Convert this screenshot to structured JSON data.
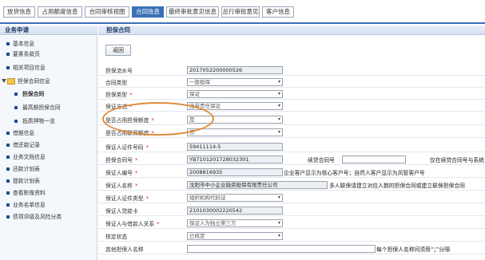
{
  "tabs": [
    {
      "label": "放贷信息",
      "active": false
    },
    {
      "label": "占用额度信息",
      "active": false
    },
    {
      "label": "合同审核视图",
      "active": false
    },
    {
      "label": "合同信息",
      "active": true
    },
    {
      "label": "最终审批意见信息",
      "active": false
    },
    {
      "label": "总行审批意见",
      "active": false
    },
    {
      "label": "客户信息",
      "active": false
    }
  ],
  "left_header": "业务申请",
  "right_header": "担保合同",
  "sidebar": [
    {
      "label": "基本信息"
    },
    {
      "label": "要素条款页"
    },
    {
      "label": "相关项目信息"
    },
    {
      "label": "担保合同信息"
    },
    {
      "label": "担保合同"
    },
    {
      "label": "最高额担保合同"
    },
    {
      "label": "抵质押物一览"
    },
    {
      "label": "借据信息"
    },
    {
      "label": "借还款记录"
    },
    {
      "label": "业务文档信息"
    },
    {
      "label": "还款计划表"
    },
    {
      "label": "提款计划表"
    },
    {
      "label": "查看影像资料"
    },
    {
      "label": "业务名单信息"
    },
    {
      "label": "债项评级及风险分类"
    }
  ],
  "back_label": "返回",
  "form": {
    "serial_label": "担保流水号",
    "serial_value": "2017052200000526",
    "contract_type_label": "合同类型",
    "contract_type_value": "一般担保",
    "guarantee_type_label": "担保类型",
    "guarantee_type_value": "保证",
    "guarantee_method_label": "保证方式",
    "guarantee_method_value": "连带责任保证",
    "occupy_label": "是否占用担保额度",
    "occupy_value": "是",
    "joint_label": "是否占用联保额度",
    "joint_value": "否",
    "id_no_label": "保证人证件号码",
    "id_no_value": "59411114-5",
    "contract_no_label": "担保合同号",
    "contract_no_value": "YB7101201728032301",
    "main_contract_label": "续贷合同号",
    "main_contract_note": "仅在续贷合同号与系统",
    "guarantor_no_label": "保证人编号",
    "guarantor_no_value": "2008816935",
    "guarantor_no_note": "企业客户显示为核心客户号；自然人客户显示为风管客户号",
    "guarantor_name_label": "保证人名称",
    "guarantor_name_value": "沈阳市中小企业融资担保有限责任公司",
    "guarantor_name_note": "多人联保请建立对应人数的担保合同或建立联保担保合同",
    "id_type_label": "保证人证件类型",
    "id_type_value": "组织机构代码证",
    "card_label": "保证人贷款卡",
    "card_value": "2101030002220542",
    "relation_label": "保证人与借款人关系",
    "relation_value": "保证人为独立第三方",
    "status_label": "核定状态",
    "status_value": "已核定",
    "others_label": "其他担保人名称",
    "others_note": "每个担保人名称间须用“；”分隔"
  }
}
